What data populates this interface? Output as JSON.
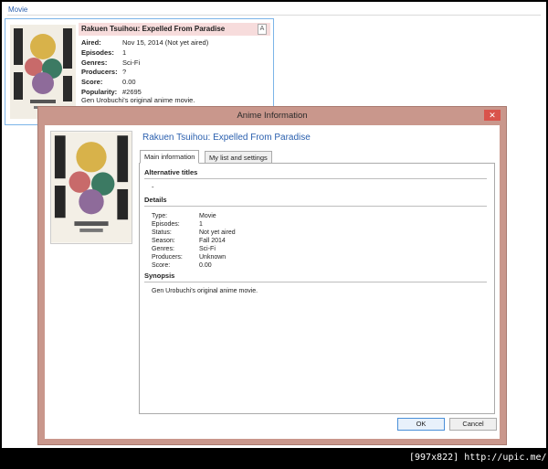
{
  "filter": {
    "label": "Movie"
  },
  "tooltip": {
    "title": "Rakuen Tsuihou: Expelled From Paradise",
    "close_label": "A",
    "rows": [
      {
        "k": "Aired:",
        "v": "Nov 15, 2014 (Not yet aired)"
      },
      {
        "k": "Episodes:",
        "v": "1"
      },
      {
        "k": "Genres:",
        "v": "Sci-Fi"
      },
      {
        "k": "Producers:",
        "v": "?"
      },
      {
        "k": "Score:",
        "v": "0.00"
      },
      {
        "k": "Popularity:",
        "v": "#2695"
      }
    ],
    "synopsis": "Gen Urobuchi's original anime movie."
  },
  "dialog": {
    "title": "Anime Information",
    "close_label": "✕",
    "anime_title": "Rakuen Tsuihou: Expelled From Paradise",
    "tabs": [
      "Main information",
      "My list and settings"
    ],
    "sections": {
      "alt_titles": "Alternative titles",
      "alt_value": "-",
      "details": "Details",
      "synopsis": "Synopsis"
    },
    "details": [
      {
        "k": "Type:",
        "v": "Movie"
      },
      {
        "k": "Episodes:",
        "v": "1"
      },
      {
        "k": "Status:",
        "v": "Not yet aired"
      },
      {
        "k": "Season:",
        "v": "Fall 2014"
      },
      {
        "k": "Genres:",
        "v": "Sci-Fi"
      },
      {
        "k": "Producers:",
        "v": "Unknown"
      },
      {
        "k": "Score:",
        "v": "0.00"
      }
    ],
    "synopsis_text": "Gen Urobuchi's original anime movie.",
    "ok_label": "OK",
    "cancel_label": "Cancel"
  },
  "footer": "[997x822] http://upic.me/",
  "colors": {
    "dialog_frame": "#c9978c",
    "link_blue": "#2a5fae",
    "title_highlight": "#f7dcdc",
    "close_red": "#d9534b"
  }
}
